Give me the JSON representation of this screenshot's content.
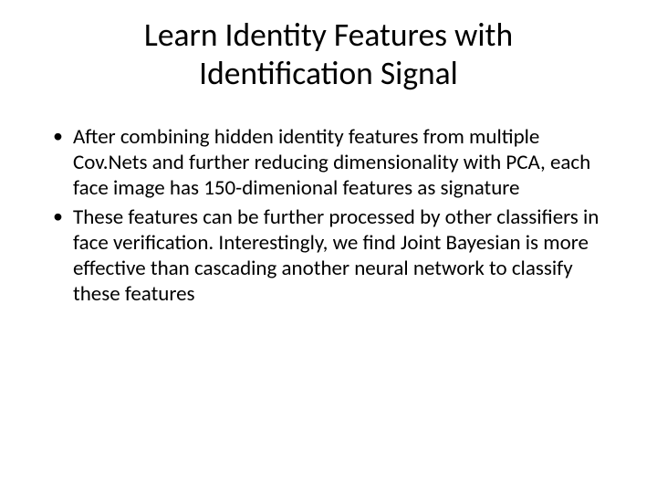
{
  "slide": {
    "title_line1": "Learn Identity Features with",
    "title_line2": "Identification Signal",
    "bullets": [
      "After combining hidden identity features from multiple Cov.Nets and further reducing dimensionality with PCA, each face image has 150-dimenional features as signature",
      "These features can be further processed by other classifiers in face verification. Interestingly, we find Joint Bayesian is more effective than cascading another neural network to classify these features"
    ]
  }
}
